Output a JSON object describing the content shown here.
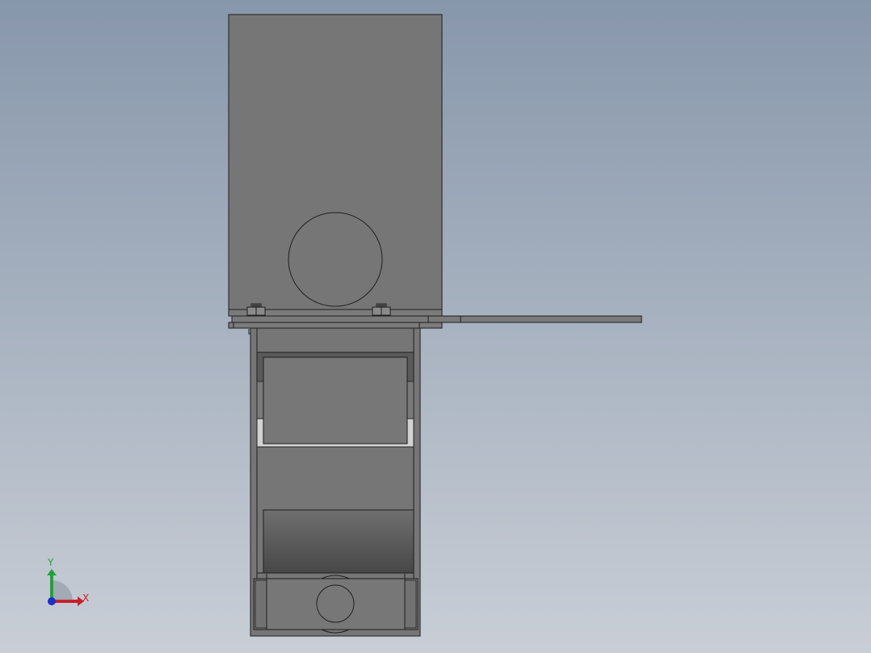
{
  "viewport": {
    "background_top": "#8797ab",
    "background_bottom": "#c9ced6"
  },
  "model": {
    "body_color": "#767676",
    "edge_color": "#1e1e1e",
    "dark_face_color": "#4e4e4e",
    "light_face_color": "#d2d2d2"
  },
  "triad": {
    "x_label": "X",
    "y_label": "Y",
    "x_color": "#c8202a",
    "y_color": "#1fa33a",
    "z_color": "#1c2fc8"
  }
}
